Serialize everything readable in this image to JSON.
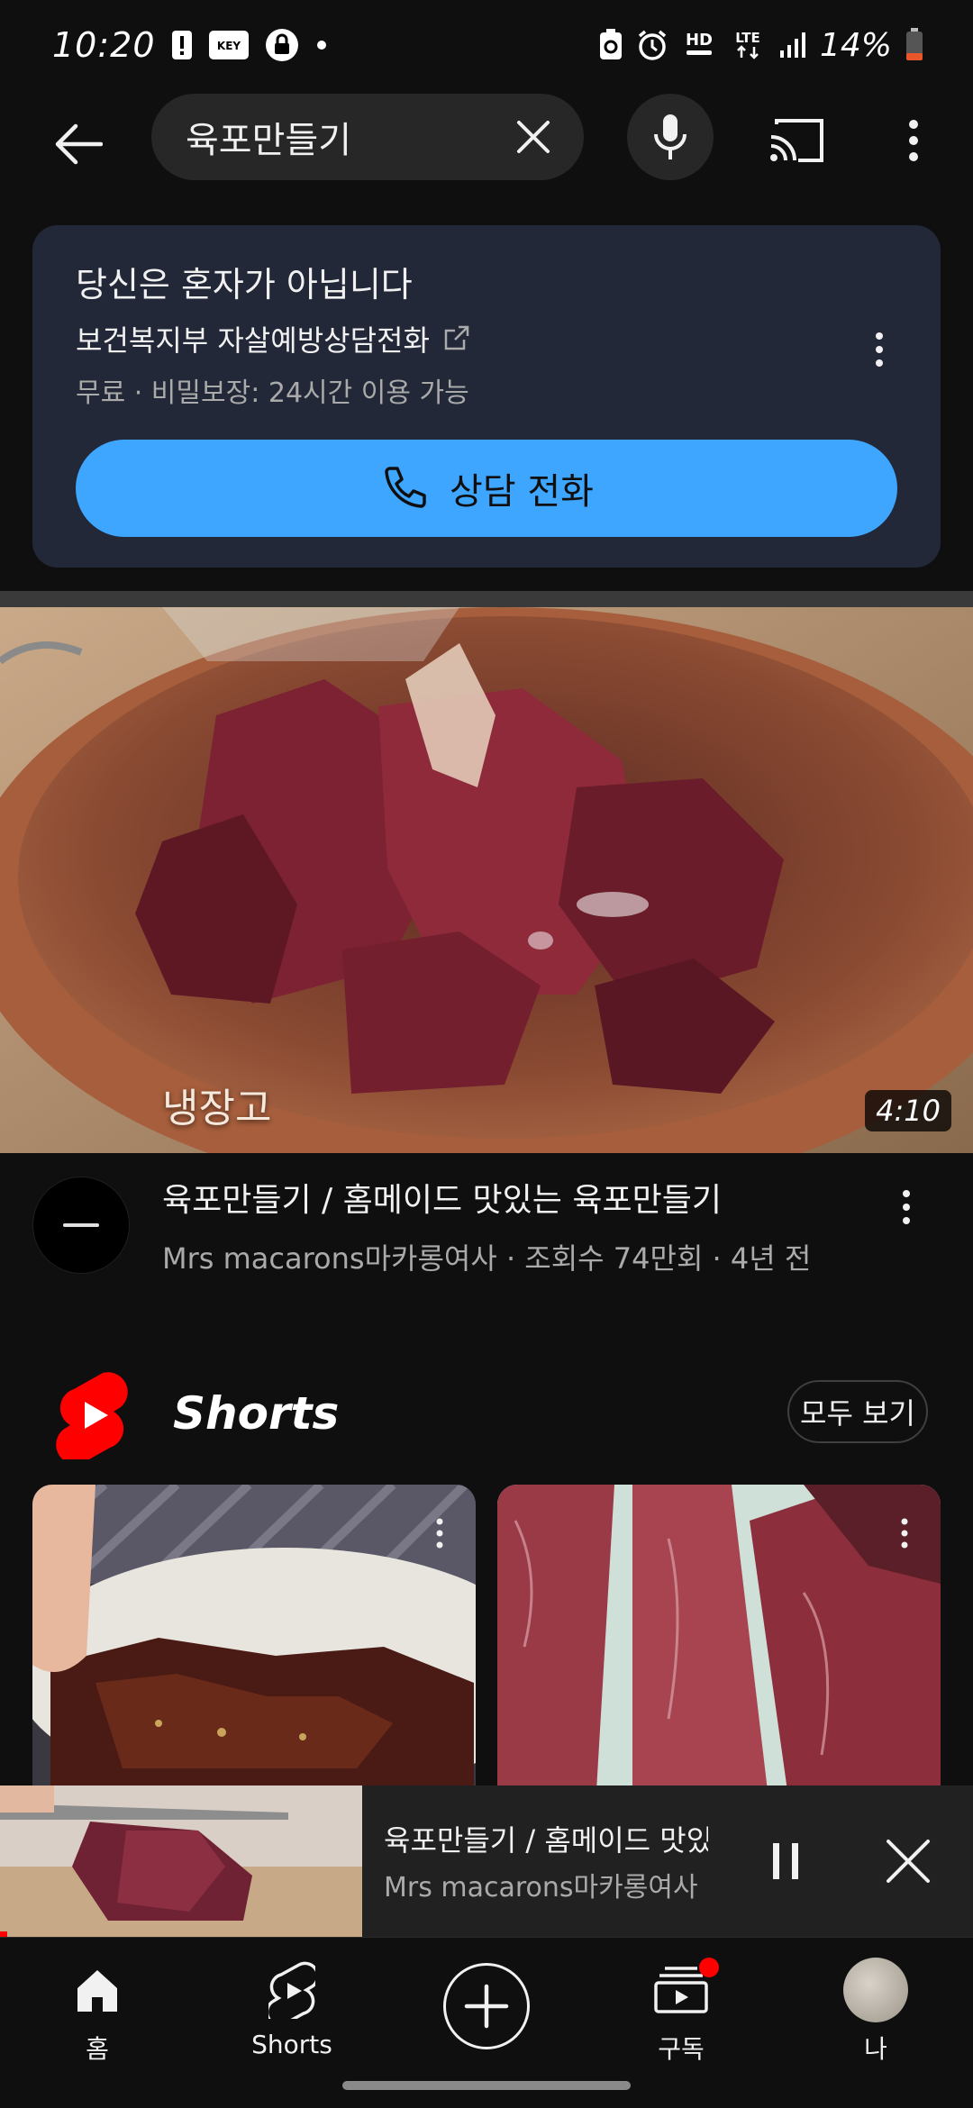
{
  "status_bar": {
    "time": "10:20",
    "battery": "14%",
    "icons_left": [
      "alert-icon",
      "key-icon",
      "lock-icon",
      "dot-icon"
    ],
    "icons_right": [
      "recycle-icon",
      "alarm-icon",
      "hd-voice-icon",
      "lte-icon",
      "signal-icon",
      "battery-icon"
    ],
    "key_label": "KEY",
    "hd_label": "HD",
    "lte_label": "LTE"
  },
  "search": {
    "query": "육포만들기"
  },
  "crisis_card": {
    "title": "당신은 혼자가 아닙니다",
    "org": "보건복지부 자살예방상담전화",
    "meta": "무료 · 비밀보장: 24시간 이용 가능",
    "call_label": "상담 전화",
    "accent_color": "#3ea6ff"
  },
  "video": {
    "thumbnail_caption": "냉장고",
    "duration": "4:10",
    "title": "육포만들기 / 홈메이드 맛있는 육포만들기",
    "meta": "Mrs macarons마카롱여사 · 조회수 74만회 · 4년 전"
  },
  "shorts": {
    "title": "Shorts",
    "view_all": "모두 보기"
  },
  "mini_player": {
    "title": "육포만들기 / 홈메이드 맛있..",
    "channel": "Mrs macarons마카롱여사",
    "progress_fraction": 0.02
  },
  "bottom_nav": {
    "items": [
      {
        "label": "홈",
        "icon": "home-icon"
      },
      {
        "label": "Shorts",
        "icon": "shorts-icon"
      },
      {
        "label": "",
        "icon": "create-icon"
      },
      {
        "label": "구독",
        "icon": "subscriptions-icon"
      },
      {
        "label": "나",
        "icon": "avatar"
      }
    ]
  }
}
